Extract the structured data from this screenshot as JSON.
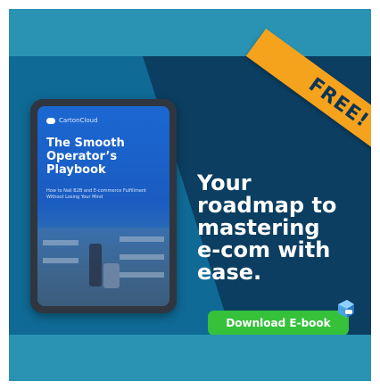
{
  "ad": {
    "ribbon_text": "FREE!",
    "headline": "Your\nroadmap to\nmastering\ne-com with\nease.",
    "cta_label": "Download E-book"
  },
  "book": {
    "brand": "CartonCloud",
    "title": "The Smooth\nOperator’s\nPlaybook",
    "subtitle": "How to Nail B2B and E-commerce Fulfillment Without Losing Your Mind"
  },
  "colors": {
    "frame_bg": "#2a93b4",
    "banner_bg": "#0b3e60",
    "accent_orange": "#f5a21d",
    "cta_green": "#35c23a",
    "book_blue": "#1b67d1"
  },
  "icons": {
    "brand": "cartoncloud-logo-icon"
  }
}
